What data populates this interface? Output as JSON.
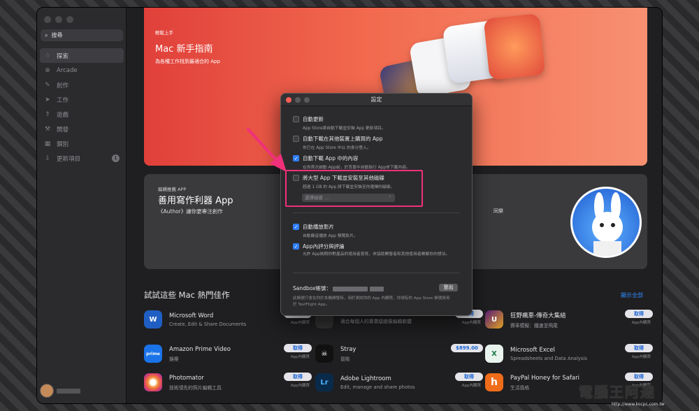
{
  "sidebar": {
    "search_placeholder": "搜尋",
    "items": [
      {
        "label": "探索",
        "icon": "star-icon"
      },
      {
        "label": "Arcade",
        "icon": "joystick-icon"
      },
      {
        "label": "創作",
        "icon": "brush-icon"
      },
      {
        "label": "工作",
        "icon": "paper-plane-icon"
      },
      {
        "label": "遊戲",
        "icon": "rocket-icon"
      },
      {
        "label": "開發",
        "icon": "hammer-icon"
      },
      {
        "label": "類別",
        "icon": "grid-icon"
      },
      {
        "label": "更新項目",
        "icon": "download-icon",
        "badge": "1"
      }
    ]
  },
  "hero": {
    "eyebrow": "輕鬆上手",
    "title": "Mac 新手指南",
    "subtitle": "為各種工作找到最適合的 App"
  },
  "feature_card": {
    "eyebrow": "編輯推薦 APP",
    "title": "善用寫作利器 App",
    "subtitle": "《Author》讓你更專注創作",
    "right_text": "同樂"
  },
  "section": {
    "title": "試試這些 Mac 熱門佳作",
    "see_all": "顯示全部"
  },
  "apps": [
    {
      "name": "Microsoft Word",
      "desc": "Create, Edit & Share Documents",
      "button": "取得",
      "iap": "App內購買",
      "color": "#1f5fc4",
      "glyph": "W"
    },
    {
      "name": "",
      "desc": "適合每個人的專業級圖像編輯軟體",
      "button": "取得",
      "iap": "App內購買",
      "color": "#333",
      "glyph": ""
    },
    {
      "name": "狂野飆車-傳奇大集結",
      "desc": "賽車模擬：纖速並飛尾",
      "button": "取得",
      "iap": "App內購買",
      "color": "#c0391c",
      "glyph": "U"
    },
    {
      "name": "Amazon Prime Video",
      "desc": "娛樂",
      "button": "取得",
      "iap": "App內購買",
      "color": "#1a73e8",
      "glyph": "prime"
    },
    {
      "name": "Stray",
      "desc": "冒險",
      "button": "$899.00",
      "iap": "",
      "color": "#111",
      "glyph": "☠"
    },
    {
      "name": "Microsoft Excel",
      "desc": "Spreadsheets and Data Analysis",
      "button": "取得",
      "iap": "App內購買",
      "color": "#1d7a45",
      "glyph": "X"
    },
    {
      "name": "Photomator",
      "desc": "技術領先的照片編輯工具",
      "button": "取得",
      "iap": "App內購買",
      "color": "#f28c33",
      "glyph": ""
    },
    {
      "name": "Adobe Lightroom",
      "desc": "Edit, manage and share photos",
      "button": "取得",
      "iap": "App內購買",
      "color": "#0a2a4a",
      "glyph": "Lr"
    },
    {
      "name": "PayPal Honey for Safari",
      "desc": "生活風格",
      "button": "取得",
      "iap": "App內購買",
      "color": "#ef6c1a",
      "glyph": "h"
    }
  ],
  "dialog": {
    "title": "設定",
    "options": [
      {
        "label": "自動更新",
        "desc": "App Store將自動下載並安裝 App 更新項目。",
        "checked": false
      },
      {
        "label": "自動下載在其他裝置上購買的 App",
        "desc": "你已在 App Store 中以                              的身分登入。",
        "checked": false
      },
      {
        "label": "自動下載 App 中的內容",
        "desc": "在你首次啟動 App前，於背景中自動執行 App來下載內容。",
        "checked": true
      },
      {
        "label": "將大型 App 下載並安裝至其他磁碟",
        "desc": "超過 1 GB 的 App 將下載並安裝至你選擇的磁碟。",
        "checked": false
      },
      {
        "label": "自動播放影片",
        "desc": "自動靜音播放 App 預覽影片。",
        "checked": true
      },
      {
        "label": "App內評分與評論",
        "desc": "允許 App詢問你對產品的使用者意見，來協助開發者和其他使用者瞭解你的想法。",
        "checked": true
      }
    ],
    "select_placeholder": "選擇磁碟 ...",
    "sandbox_label": "Sandbox帳號：",
    "logout": "登出",
    "footer": "此帳號只會在你於本機開發時，用於測試你的 App 內購買。你現有的 App Store 帳號將用於 TestFlight App。"
  },
  "user": {
    "name": ""
  },
  "watermark": {
    "text": "電腦王阿達",
    "url": "http://www.kocpc.com.tw"
  }
}
